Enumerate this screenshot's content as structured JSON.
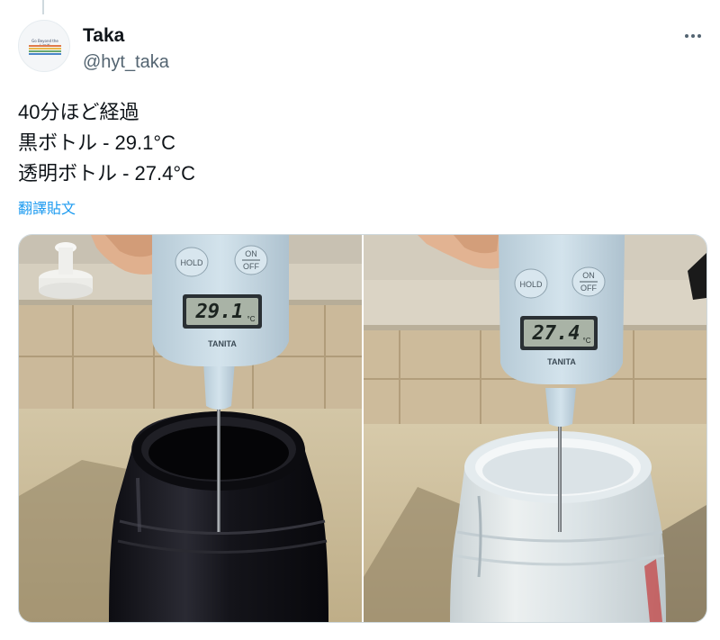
{
  "author": {
    "name": "Taka",
    "handle": "@hyt_taka",
    "avatar_tagline": "Go Beyond the Limit!",
    "avatar_stripe_colors": [
      "#e07a4a",
      "#e8b84a",
      "#6aa86a",
      "#4a86c8"
    ]
  },
  "tweet": {
    "lines": [
      "40分ほど経過",
      "黒ボトル - 29.1°C",
      "透明ボトル - 27.4°C"
    ],
    "translate_label": "翻譯貼文"
  },
  "media": {
    "left": {
      "hold_label": "HOLD",
      "on_label": "ON",
      "off_label": "OFF",
      "reading": "29.1",
      "unit": "°C",
      "brand": "TANITA"
    },
    "right": {
      "hold_label": "HOLD",
      "on_label": "ON",
      "off_label": "OFF",
      "reading": "27.4",
      "unit": "°C",
      "brand": "TANITA"
    }
  },
  "colors": {
    "link": "#1d9bf0",
    "secondary_text": "#536471",
    "thermometer_body": "#c9dbe5",
    "black_bottle": "#1c1c20",
    "clear_bottle": "#dde6ea"
  }
}
